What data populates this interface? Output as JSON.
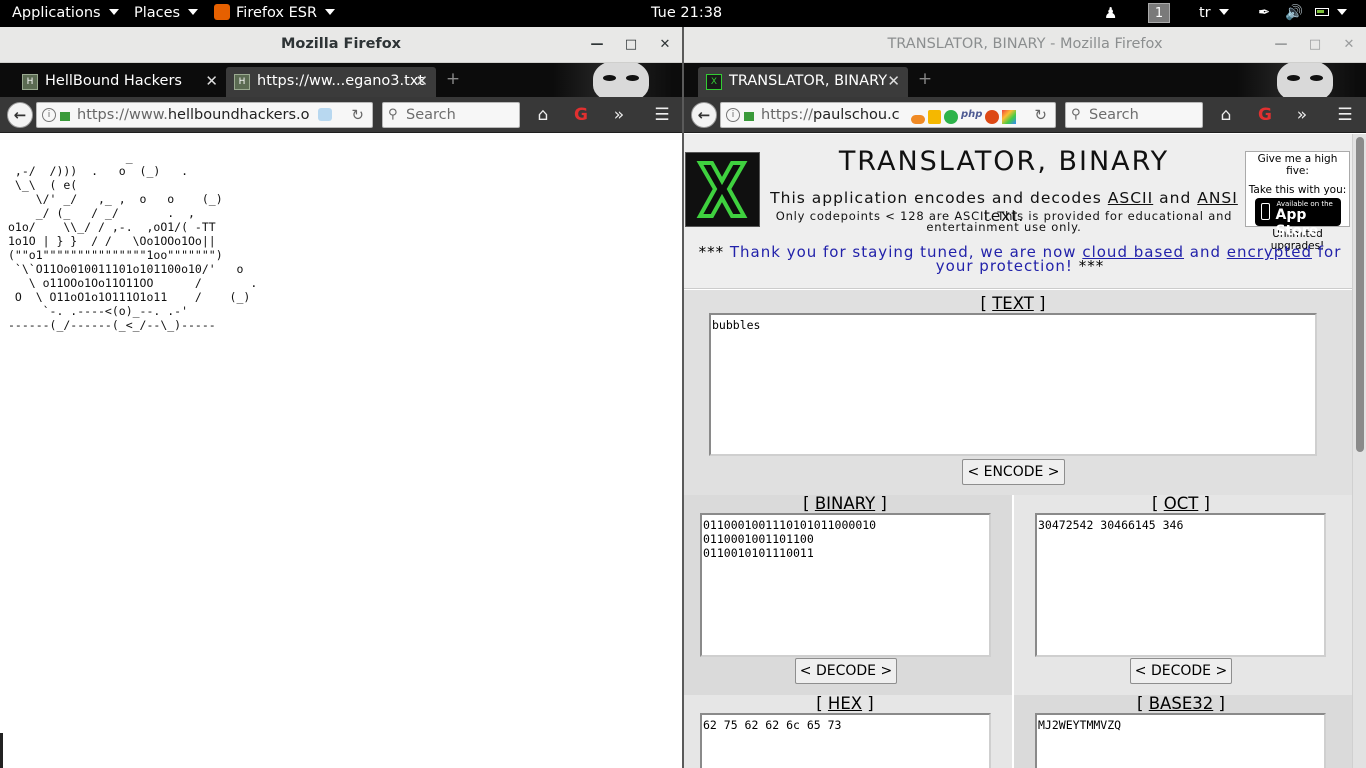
{
  "topbar": {
    "applications": "Applications",
    "places": "Places",
    "firefox_esr": "Firefox ESR",
    "clock": "Tue 21:38",
    "workspace": "1",
    "keyboard": "tr"
  },
  "left_window": {
    "title": "Mozilla Firefox",
    "tabs": [
      {
        "label": "HellBound Hackers",
        "favicon": "hbh-favicon"
      },
      {
        "label": "https://ww...egano3.txt",
        "favicon": "hbh-favicon"
      }
    ],
    "url_prefix": "https://www.",
    "url_host": "hellboundhackers.o",
    "search_placeholder": "Search",
    "ascii_art": "                 _\n ,-/  /)))  .   o  (_)   .\n \\_\\  ( e(\n    \\/' _/   ,_ ,  o   o    (_)\n    _/ (_   / _/       .  ,\no1o/    \\\\_/ / ,-.  ,oO1/( -TT\n1o1O | } }  / /   \\Oo1OOo1Oo||\n(\"\"o1\"\"\"\"\"\"\"\"\"\"\"\"\"\"\"1oo\"\"\"\"\"\"\")\n `\\`O11Oo010011101o101100o10/'   o\n   \\ o11OOo1Oo11O11OO      /       .\n O  \\ O11oO1o1O111O1o11    /    (_)\n     `-. .----<(o)_--. .-'\n------(_/------(_<_/--\\_)-----"
  },
  "right_window": {
    "title": "TRANSLATOR, BINARY - Mozilla Firefox",
    "tab_label": "TRANSLATOR, BINARY",
    "url_prefix": "https://",
    "url_host": "paulschou.c",
    "search_placeholder": "Search"
  },
  "page": {
    "title": "TRANSLATOR, BINARY",
    "subtitle_pre": "This application encodes and decodes ",
    "subtitle_ascii": "ASCII",
    "subtitle_and": " and ",
    "subtitle_ansi": "ANSI",
    "subtitle_post": " text.",
    "note": "Only codepoints < 128 are ASCII. This is provided for educational and entertainment use only.",
    "promo": {
      "line1": "Give me a high five:",
      "line2": "Take this with you:",
      "badge_small": "Available on the",
      "badge_big": "App Store",
      "line3": "Unlimited upgrades!"
    },
    "notice_stars": "***",
    "notice_pre": " Thank you for staying tuned, we are now ",
    "notice_link1": "cloud based",
    "notice_and": " and ",
    "notice_link2": "encrypted",
    "notice_post": " for your protection! ",
    "bracket_open": "[ ",
    "bracket_close": " ]",
    "text_section": {
      "label": "TEXT",
      "value": "bubbles",
      "button": "< ENCODE >"
    },
    "binary_section": {
      "label": "BINARY",
      "value": "0110001001110101011000010\n0110001001101100\n0110010101110011",
      "button": "< DECODE >"
    },
    "oct_section": {
      "label": "OCT",
      "value": "30472542 30466145 346",
      "button": "< DECODE >"
    },
    "hex_section": {
      "label": "HEX",
      "value": "62 75 62 62 6c 65 73"
    },
    "base32_section": {
      "label": "BASE32",
      "value": "MJ2WEYTMMVZQ"
    }
  }
}
